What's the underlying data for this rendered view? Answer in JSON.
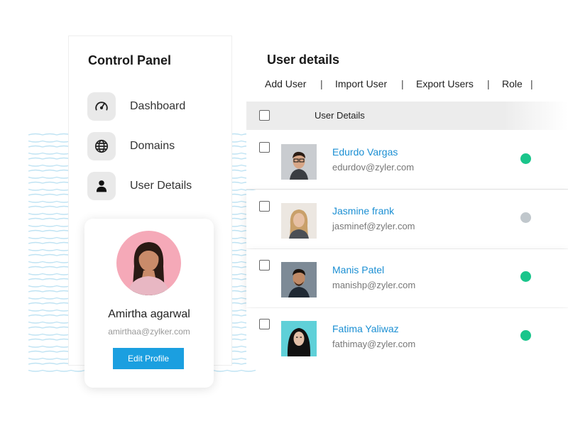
{
  "colors": {
    "accent": "#1b9fe0",
    "link": "#1b8fd3",
    "online": "#1ac58b",
    "offline": "#c0c7cc"
  },
  "control_panel": {
    "title": "Control Panel",
    "nav": [
      {
        "label": "Dashboard",
        "icon": "speedometer-icon"
      },
      {
        "label": "Domains",
        "icon": "globe-icon"
      },
      {
        "label": "User Details",
        "icon": "user-icon"
      }
    ]
  },
  "profile": {
    "name": "Amirtha agarwal",
    "email": "amirthaa@zylker.com",
    "edit_label": "Edit Profile"
  },
  "user_details": {
    "title": "User details",
    "toolbar": {
      "add": "Add User",
      "import": "Import User",
      "export": "Export Users",
      "role": "Role",
      "separator": "|"
    },
    "header_label": "User Details",
    "users": [
      {
        "name": "Edurdo Vargas",
        "email": "edurdov@zyler.com",
        "status": "online"
      },
      {
        "name": "Jasmine frank",
        "email": "jasminef@zyler.com",
        "status": "offline"
      },
      {
        "name": "Manis Patel",
        "email": "manishp@zyler.com",
        "status": "online"
      },
      {
        "name": "Fatima Yaliwaz",
        "email": "fathimay@zyler.com",
        "status": "online"
      }
    ]
  }
}
